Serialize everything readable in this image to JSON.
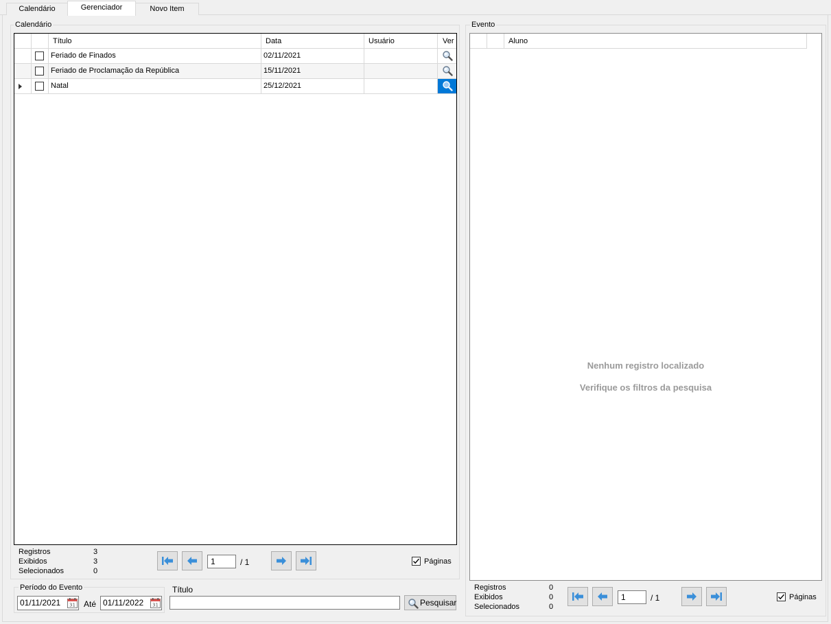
{
  "tabs": [
    {
      "label": "Calendário",
      "active": false
    },
    {
      "label": "Gerenciador",
      "active": true
    },
    {
      "label": "Novo Item",
      "active": false
    }
  ],
  "left_group": {
    "title": "Calendário",
    "columns": [
      "Título",
      "Data",
      "Usuário",
      "Ver"
    ],
    "rows": [
      {
        "titulo": "Feriado de Finados",
        "data": "02/11/2021",
        "usuario": "",
        "checked": false,
        "current": false
      },
      {
        "titulo": "Feriado de Proclamação da República",
        "data": "15/11/2021",
        "usuario": "",
        "checked": false,
        "current": false
      },
      {
        "titulo": "Natal",
        "data": "25/12/2021",
        "usuario": "",
        "checked": false,
        "current": true
      }
    ],
    "stats": {
      "registros_label": "Registros",
      "registros": "3",
      "exibidos_label": "Exibidos",
      "exibidos": "3",
      "selecionados_label": "Selecionados",
      "selecionados": "0"
    },
    "pager": {
      "page": "1",
      "of": "/ 1",
      "paginas_label": "Páginas",
      "paginas_checked": true
    }
  },
  "periodo": {
    "title": "Período do Evento",
    "from": "01/11/2021",
    "ate_label": "Até",
    "to": "01/11/2022"
  },
  "titulo_filter": {
    "label": "Título",
    "value": ""
  },
  "search_button": {
    "label": "Pesquisar"
  },
  "right_group": {
    "title": "Evento",
    "columns": [
      "Aluno"
    ],
    "empty_line1": "Nenhum registro localizado",
    "empty_line2": "Verifique os filtros da pesquisa",
    "stats": {
      "registros_label": "Registros",
      "registros": "0",
      "exibidos_label": "Exibidos",
      "exibidos": "0",
      "selecionados_label": "Selecionados",
      "selecionados": "0"
    },
    "pager": {
      "page": "1",
      "of": "/ 1",
      "paginas_label": "Páginas",
      "paginas_checked": true
    }
  },
  "colors": {
    "selection": "#0078d7",
    "nav_arrow": "#3a8fd9"
  }
}
